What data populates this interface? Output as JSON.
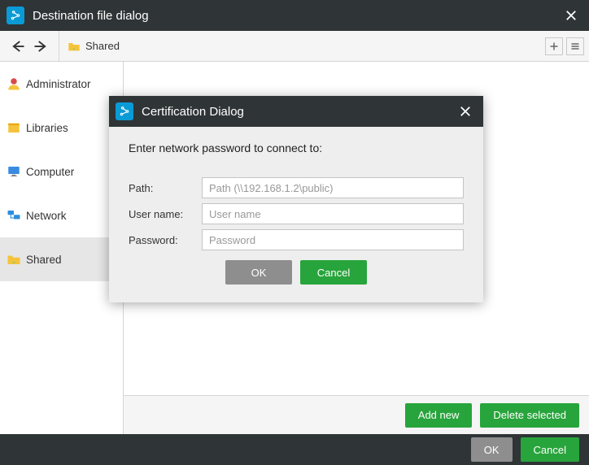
{
  "window": {
    "title": "Destination file dialog"
  },
  "breadcrumb": {
    "label": "Shared"
  },
  "sidebar": {
    "items": [
      {
        "label": "Administrator"
      },
      {
        "label": "Libraries"
      },
      {
        "label": "Computer"
      },
      {
        "label": "Network"
      },
      {
        "label": "Shared"
      }
    ]
  },
  "actions": {
    "add_new": "Add new",
    "delete_selected": "Delete selected"
  },
  "bottom": {
    "ok": "OK",
    "cancel": "Cancel"
  },
  "cert_dialog": {
    "title": "Certification Dialog",
    "message": "Enter network password to connect to:",
    "path_label": "Path:",
    "path_placeholder": "Path (\\\\192.168.1.2\\public)",
    "path_value": "",
    "user_label": "User name:",
    "user_placeholder": "User name",
    "user_value": "",
    "password_label": "Password:",
    "password_placeholder": "Password",
    "password_value": "",
    "ok": "OK",
    "cancel": "Cancel"
  }
}
